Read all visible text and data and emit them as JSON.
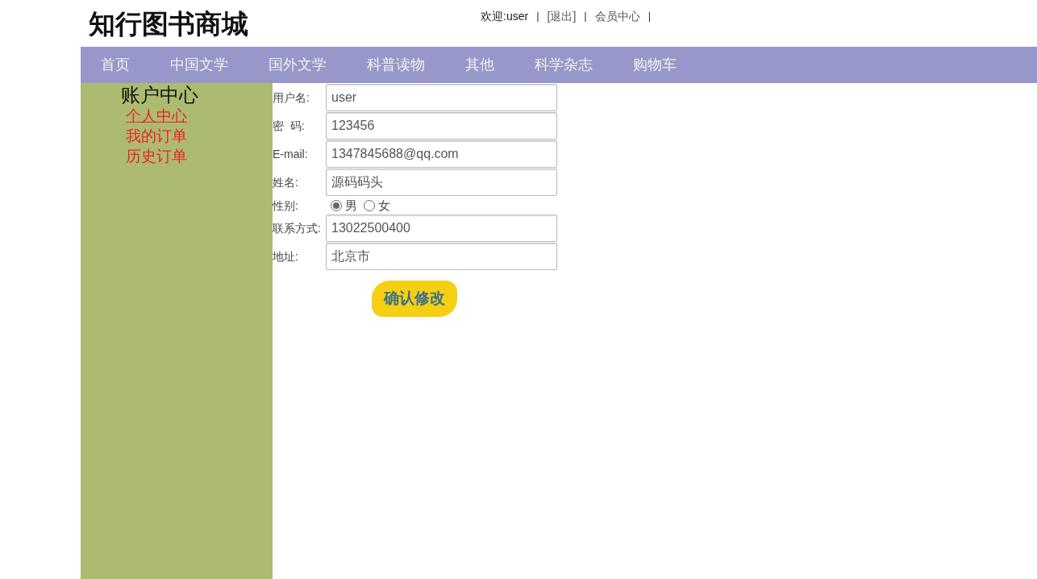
{
  "header": {
    "logo": "知行图书商城",
    "user_links": [
      {
        "kind": "text",
        "label": "欢迎:user"
      },
      {
        "kind": "sep",
        "label": "|"
      },
      {
        "kind": "link",
        "label": "[退出]"
      },
      {
        "kind": "sep",
        "label": "|"
      },
      {
        "kind": "link",
        "label": "会员中心"
      },
      {
        "kind": "sep",
        "label": "|"
      }
    ]
  },
  "nav": [
    {
      "label": "首页"
    },
    {
      "label": "中国文学"
    },
    {
      "label": "国外文学"
    },
    {
      "label": "科普读物"
    },
    {
      "label": "其他"
    },
    {
      "label": "科学杂志"
    },
    {
      "label": "购物车"
    }
  ],
  "sidebar": {
    "title": "账户中心",
    "items": [
      {
        "label": "个人中心",
        "selected": true
      },
      {
        "label": "我的订单",
        "selected": false
      },
      {
        "label": "历史订单",
        "selected": false
      }
    ]
  },
  "form": {
    "fields": [
      {
        "kind": "text",
        "label": "用户名:",
        "value": "user"
      },
      {
        "kind": "text",
        "label": "密  码:",
        "value": "123456"
      },
      {
        "kind": "text",
        "label": "E-mail:",
        "value": "1347845688@qq.com"
      },
      {
        "kind": "text",
        "label": "姓名:",
        "value": "源码码头"
      },
      {
        "kind": "radio",
        "label": "性别:",
        "options": [
          {
            "label": "男",
            "selected": true
          },
          {
            "label": "女",
            "selected": false
          }
        ]
      },
      {
        "kind": "text",
        "label": "联系方式:",
        "value": "13022500400"
      },
      {
        "kind": "text",
        "label": "地址:",
        "value": "北京市"
      }
    ],
    "submit": "确认修改"
  }
}
